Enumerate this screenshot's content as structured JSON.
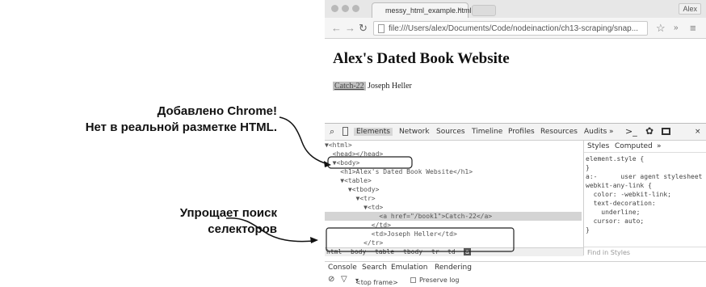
{
  "annotations": {
    "chrome_added_line1": "Добавлено Chrome!",
    "chrome_added_line2": "Нет в реальной разметке HTML.",
    "selector_line1": "Упрощает поиск",
    "selector_line2": "селекторов"
  },
  "browser": {
    "tab_title": "messy_html_example.html",
    "tab_close": "×",
    "profile": "Alex",
    "url": "file:///Users/alex/Documents/Code/nodeinaction/ch13-scraping/snap...",
    "page_heading": "Alex's Dated Book Website",
    "book_link": "Catch-22",
    "book_author": "Joseph Heller"
  },
  "devtools": {
    "tabs": [
      "Elements",
      "Network",
      "Sources",
      "Timeline",
      "Profiles",
      "Resources",
      "Audits",
      "»"
    ],
    "elements_lines": [
      "▼<html>",
      "  <head></head>",
      "  ▼<body>",
      "    <h1>Alex's Dated Book Website</h1>",
      "    ▼<table>",
      "      ▼<tbody>",
      "        ▼<tr>",
      "          ▼<td>",
      "              <a href=\"/book1\">Catch-22</a>",
      "            </td>",
      "            <td>Joseph Heller</td>",
      "          </tr>"
    ],
    "selected_line_index": 8,
    "styles_tabs": [
      "Styles",
      "Computed",
      "»"
    ],
    "styles_lines": [
      "element.style {",
      "}",
      "a:-      user agent stylesheet",
      "webkit-any-link {",
      "  color: -webkit-link;",
      "  text-decoration:",
      "    underline;",
      "  cursor: auto;",
      "}"
    ],
    "find_in_styles": "Find in Styles",
    "breadcrumbs": [
      "html",
      "body",
      "table",
      "tbody",
      "tr",
      "td",
      "a"
    ],
    "drawer_tabs": [
      "Console",
      "Search",
      "Emulation",
      "Rendering"
    ],
    "frame_select": "<top frame>",
    "preserve_log": "Preserve log"
  }
}
